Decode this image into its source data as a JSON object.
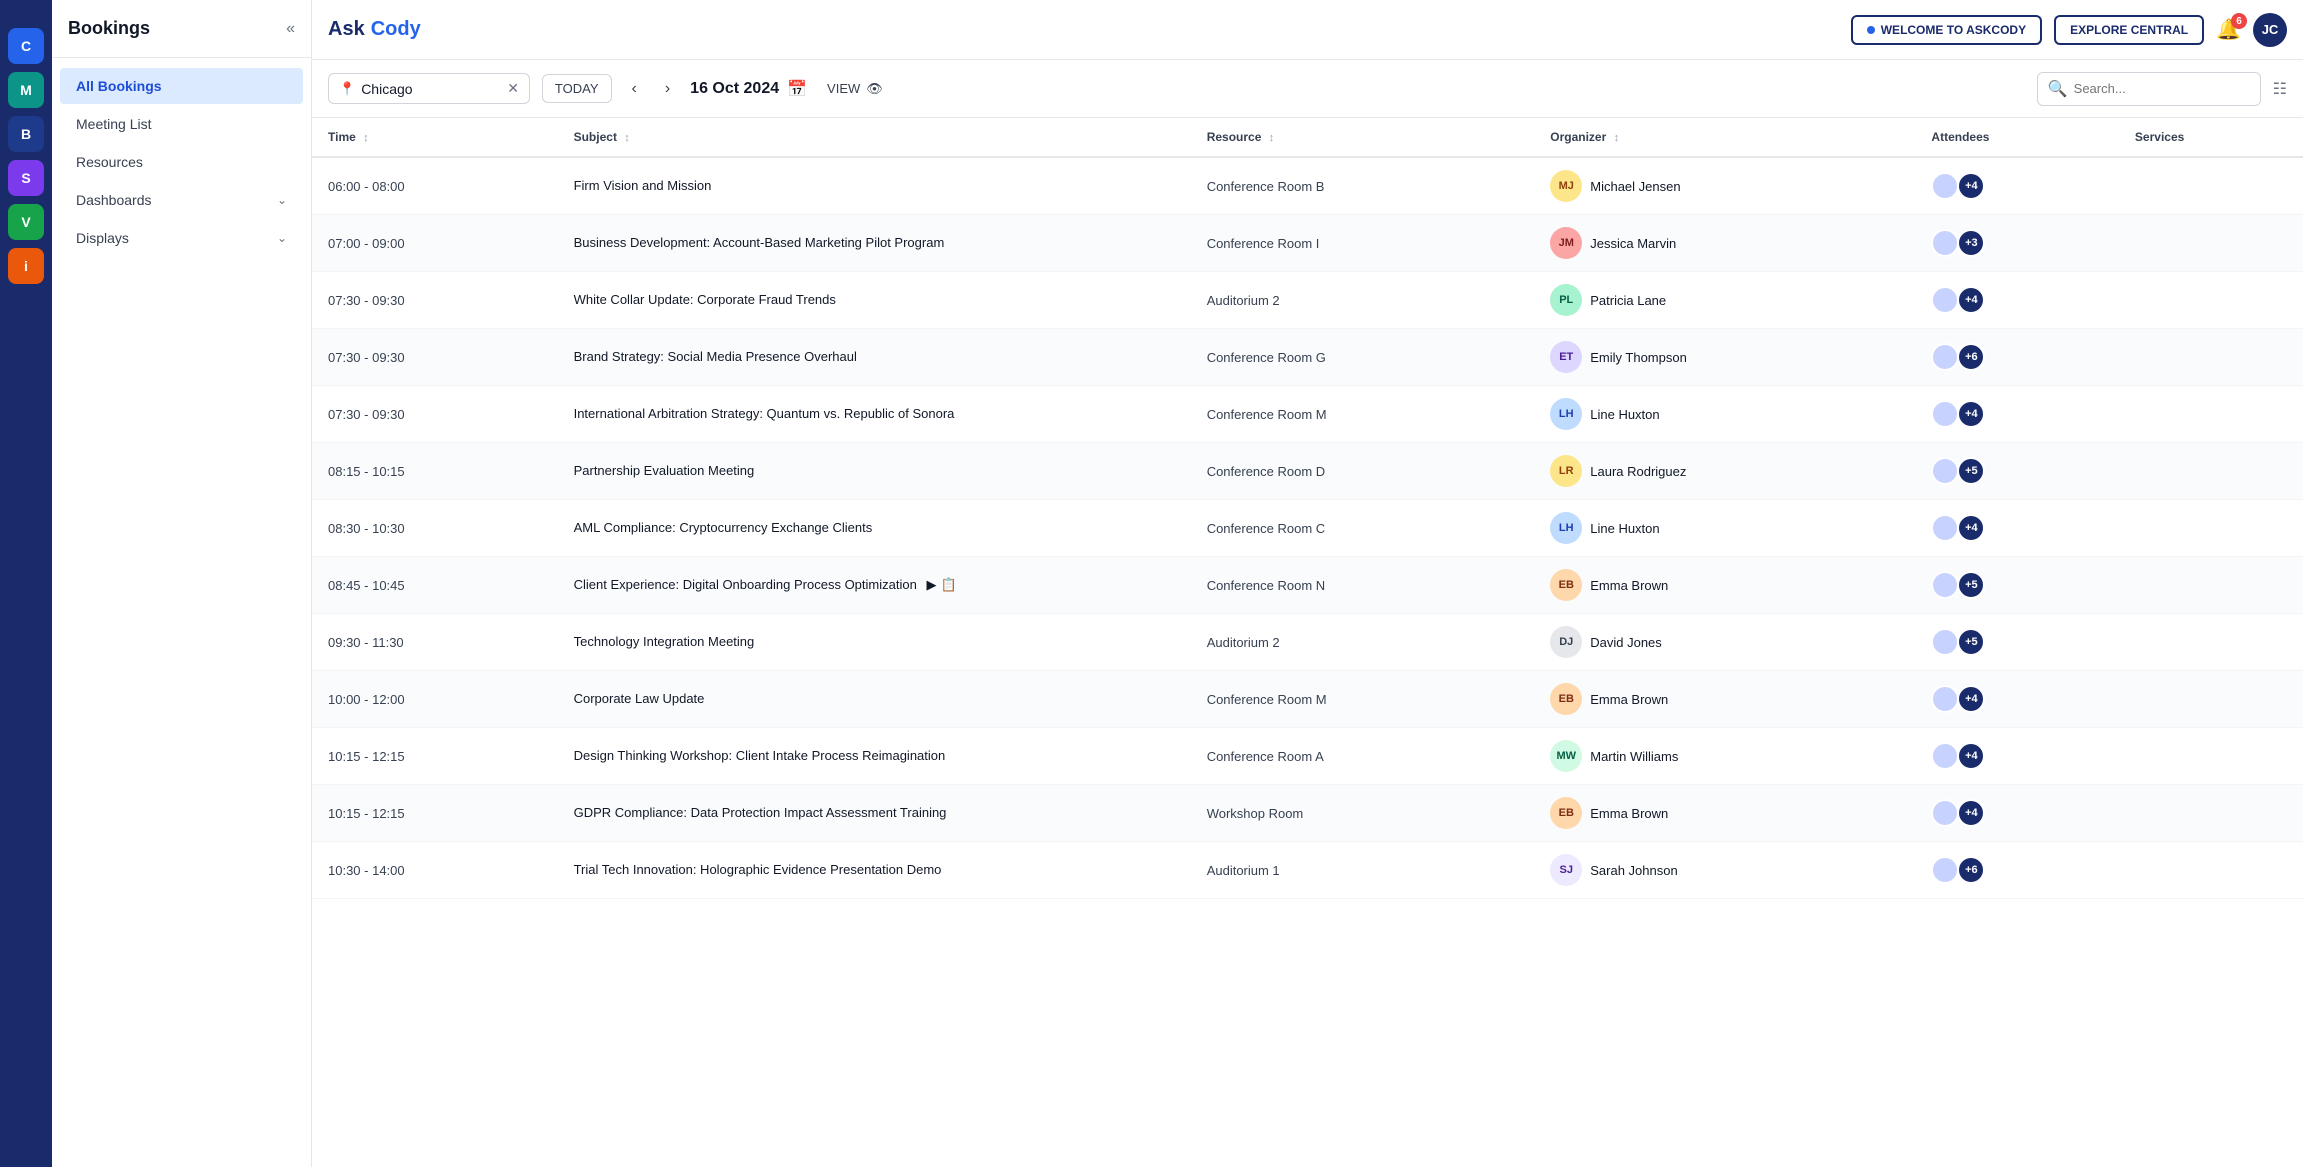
{
  "app": {
    "name_ask": "Ask",
    "name_cody": "Cody",
    "welcome_btn": "WELCOME TO ASKCODY",
    "explore_btn": "EXPLORE CENTRAL",
    "notif_count": "6",
    "user_initials": "JC"
  },
  "sidebar": {
    "title": "Bookings",
    "items": [
      {
        "id": "all-bookings",
        "label": "All Bookings",
        "active": true
      },
      {
        "id": "meeting-list",
        "label": "Meeting List",
        "active": false
      },
      {
        "id": "resources",
        "label": "Resources",
        "active": false
      },
      {
        "id": "dashboards",
        "label": "Dashboards",
        "active": false,
        "has_chevron": true
      },
      {
        "id": "displays",
        "label": "Displays",
        "active": false,
        "has_chevron": true
      }
    ]
  },
  "icon_bar": [
    {
      "id": "c-icon",
      "label": "C",
      "color": "blue"
    },
    {
      "id": "m-icon",
      "label": "M",
      "color": "teal"
    },
    {
      "id": "b-icon",
      "label": "B",
      "color": "navy"
    },
    {
      "id": "s-icon",
      "label": "S",
      "color": "purple"
    },
    {
      "id": "v-icon",
      "label": "V",
      "color": "green"
    },
    {
      "id": "i-icon",
      "label": "i",
      "color": "orange"
    }
  ],
  "toolbar": {
    "location": "Chicago",
    "today_label": "TODAY",
    "date": "16 Oct 2024",
    "view_label": "VIEW",
    "search_placeholder": "Search..."
  },
  "table": {
    "columns": [
      "Time",
      "Subject",
      "Resource",
      "Organizer",
      "Attendees",
      "Services"
    ],
    "rows": [
      {
        "time": "06:00 - 08:00",
        "subject": "Firm Vision and Mission",
        "resource": "Conference Room B",
        "organizer": "Michael Jensen",
        "organizer_initials": "MJ",
        "organizer_color": "av-michael",
        "attendees": 5,
        "attendees_count_label": "+4",
        "has_icons": false
      },
      {
        "time": "07:00 - 09:00",
        "subject": "Business Development: Account-Based Marketing Pilot Program",
        "resource": "Conference Room I",
        "organizer": "Jessica Marvin",
        "organizer_initials": "JM",
        "organizer_color": "av-jessica",
        "attendees": 4,
        "attendees_count_label": "+3",
        "has_icons": false
      },
      {
        "time": "07:30 - 09:30",
        "subject": "White Collar Update: Corporate Fraud Trends",
        "resource": "Auditorium 2",
        "organizer": "Patricia Lane",
        "organizer_initials": "PL",
        "organizer_color": "av-patricia",
        "attendees": 5,
        "attendees_count_label": "+4",
        "has_icons": false
      },
      {
        "time": "07:30 - 09:30",
        "subject": "Brand Strategy: Social Media Presence Overhaul",
        "resource": "Conference Room G",
        "organizer": "Emily Thompson",
        "organizer_initials": "ET",
        "organizer_color": "av-emily",
        "attendees": 7,
        "attendees_count_label": "+6",
        "has_icons": false
      },
      {
        "time": "07:30 - 09:30",
        "subject": "International Arbitration Strategy: Quantum vs. Republic of Sonora",
        "resource": "Conference Room M",
        "organizer": "Line Huxton",
        "organizer_initials": "LH",
        "organizer_color": "av-line",
        "attendees": 5,
        "attendees_count_label": "+4",
        "has_icons": false
      },
      {
        "time": "08:15 - 10:15",
        "subject": "Partnership Evaluation Meeting",
        "resource": "Conference Room D",
        "organizer": "Laura Rodriguez",
        "organizer_initials": "LR",
        "organizer_color": "av-laura",
        "attendees": 6,
        "attendees_count_label": "+5",
        "has_icons": false
      },
      {
        "time": "08:30 - 10:30",
        "subject": "AML Compliance: Cryptocurrency Exchange Clients",
        "resource": "Conference Room C",
        "organizer": "Line Huxton",
        "organizer_initials": "LH",
        "organizer_color": "av-line",
        "attendees": 5,
        "attendees_count_label": "+4",
        "has_icons": false
      },
      {
        "time": "08:45 - 10:45",
        "subject": "Client Experience: Digital Onboarding Process Optimization",
        "resource": "Conference Room N",
        "organizer": "Emma Brown",
        "organizer_initials": "EB",
        "organizer_color": "av-emma",
        "attendees": 6,
        "attendees_count_label": "+5",
        "has_icons": true
      },
      {
        "time": "09:30 - 11:30",
        "subject": "Technology Integration Meeting",
        "resource": "Auditorium 2",
        "organizer": "David Jones",
        "organizer_initials": "DJ",
        "organizer_color": "av-david",
        "attendees": 6,
        "attendees_count_label": "+5",
        "has_icons": false
      },
      {
        "time": "10:00 - 12:00",
        "subject": "Corporate Law Update",
        "resource": "Conference Room M",
        "organizer": "Emma Brown",
        "organizer_initials": "EB",
        "organizer_color": "av-emma",
        "attendees": 5,
        "attendees_count_label": "+4",
        "has_icons": false
      },
      {
        "time": "10:15 - 12:15",
        "subject": "Design Thinking Workshop: Client Intake Process Reimagination",
        "resource": "Conference Room A",
        "organizer": "Martin Williams",
        "organizer_initials": "MW",
        "organizer_color": "av-martin",
        "attendees": 5,
        "attendees_count_label": "+4",
        "has_icons": false
      },
      {
        "time": "10:15 - 12:15",
        "subject": "GDPR Compliance: Data Protection Impact Assessment Training",
        "resource": "Workshop Room",
        "organizer": "Emma Brown",
        "organizer_initials": "EB",
        "organizer_color": "av-emma",
        "attendees": 5,
        "attendees_count_label": "+4",
        "has_icons": false
      },
      {
        "time": "10:30 - 14:00",
        "subject": "Trial Tech Innovation: Holographic Evidence Presentation Demo",
        "resource": "Auditorium 1",
        "organizer": "Sarah Johnson",
        "organizer_initials": "SJ",
        "organizer_color": "av-sarah",
        "attendees": 7,
        "attendees_count_label": "+6",
        "has_icons": false
      }
    ]
  }
}
